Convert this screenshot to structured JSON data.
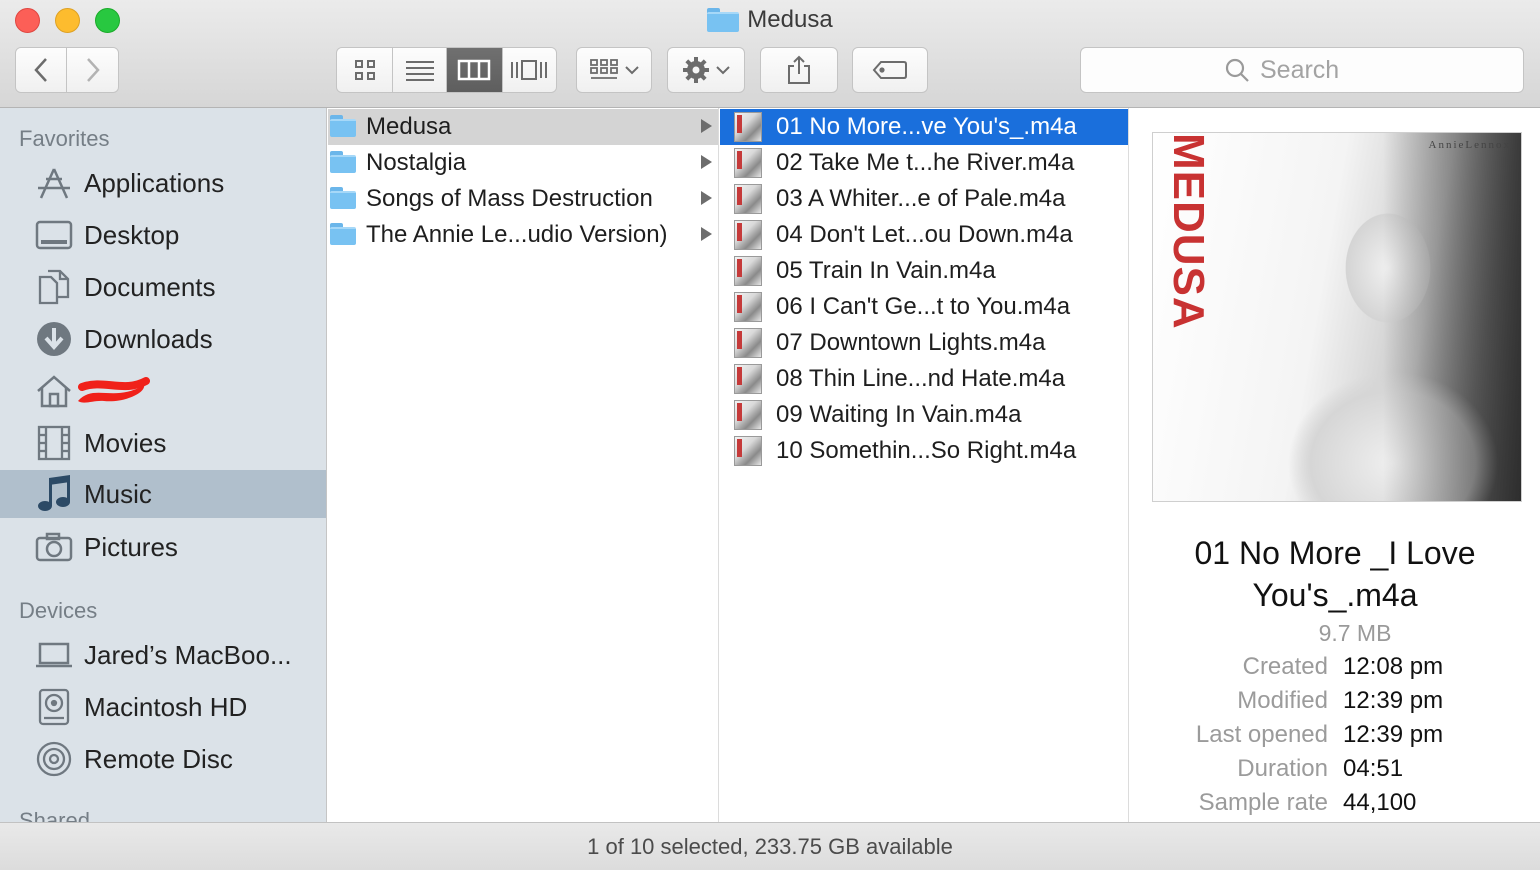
{
  "window": {
    "title": "Medusa"
  },
  "toolbar": {
    "back_icon": "chevron-left-icon",
    "forward_icon": "chevron-right-icon",
    "view_modes": [
      "icon-view",
      "list-view",
      "column-view",
      "cover-flow-view"
    ],
    "active_view": "column-view",
    "search_placeholder": "Search"
  },
  "sidebar": {
    "favorites_header": "Favorites",
    "favorites": [
      {
        "label": "Applications",
        "icon": "applications-icon"
      },
      {
        "label": "Desktop",
        "icon": "desktop-icon"
      },
      {
        "label": "Documents",
        "icon": "documents-icon"
      },
      {
        "label": "Downloads",
        "icon": "downloads-icon"
      },
      {
        "label": "",
        "icon": "home-icon"
      },
      {
        "label": "Movies",
        "icon": "movies-icon"
      },
      {
        "label": "Music",
        "icon": "music-icon",
        "selected": true
      },
      {
        "label": "Pictures",
        "icon": "pictures-icon"
      }
    ],
    "devices_header": "Devices",
    "devices": [
      {
        "label": "Jared’s MacBoo...",
        "icon": "laptop-icon"
      },
      {
        "label": "Macintosh HD",
        "icon": "hard-drive-icon"
      },
      {
        "label": "Remote Disc",
        "icon": "disc-icon"
      }
    ],
    "shared_header": "Shared"
  },
  "column1": {
    "items": [
      {
        "name": "Medusa",
        "selected": true
      },
      {
        "name": "Nostalgia"
      },
      {
        "name": "Songs of Mass Destruction"
      },
      {
        "name": "The Annie Le...udio Version)"
      }
    ]
  },
  "column2": {
    "items": [
      {
        "name": "01 No More...ve You's_.m4a",
        "selected": true
      },
      {
        "name": "02 Take Me t...he River.m4a"
      },
      {
        "name": "03 A Whiter...e of Pale.m4a"
      },
      {
        "name": "04 Don't Let...ou Down.m4a"
      },
      {
        "name": "05 Train In Vain.m4a"
      },
      {
        "name": "06 I Can't Ge...t to You.m4a"
      },
      {
        "name": "07 Downtown Lights.m4a"
      },
      {
        "name": "08 Thin Line...nd Hate.m4a"
      },
      {
        "name": "09 Waiting In Vain.m4a"
      },
      {
        "name": "10 Somethin...So Right.m4a"
      }
    ]
  },
  "preview": {
    "album_title_art": "MEDUSA",
    "artist_art": "AnnieLennox",
    "title_line1": "01 No More _I Love",
    "title_line2": "You's_.m4a",
    "size": "9.7 MB",
    "info": [
      {
        "key": "Created",
        "value": "12:08 pm"
      },
      {
        "key": "Modified",
        "value": "12:39 pm"
      },
      {
        "key": "Last opened",
        "value": "12:39 pm"
      },
      {
        "key": "Duration",
        "value": "04:51"
      },
      {
        "key": "Sample rate",
        "value": "44,100"
      }
    ]
  },
  "status": {
    "text": "1 of 10 selected, 233.75 GB available"
  },
  "colors": {
    "selection": "#1a6fdc",
    "sidebar": "#dbe2e8",
    "folder": "#78c2f2"
  }
}
